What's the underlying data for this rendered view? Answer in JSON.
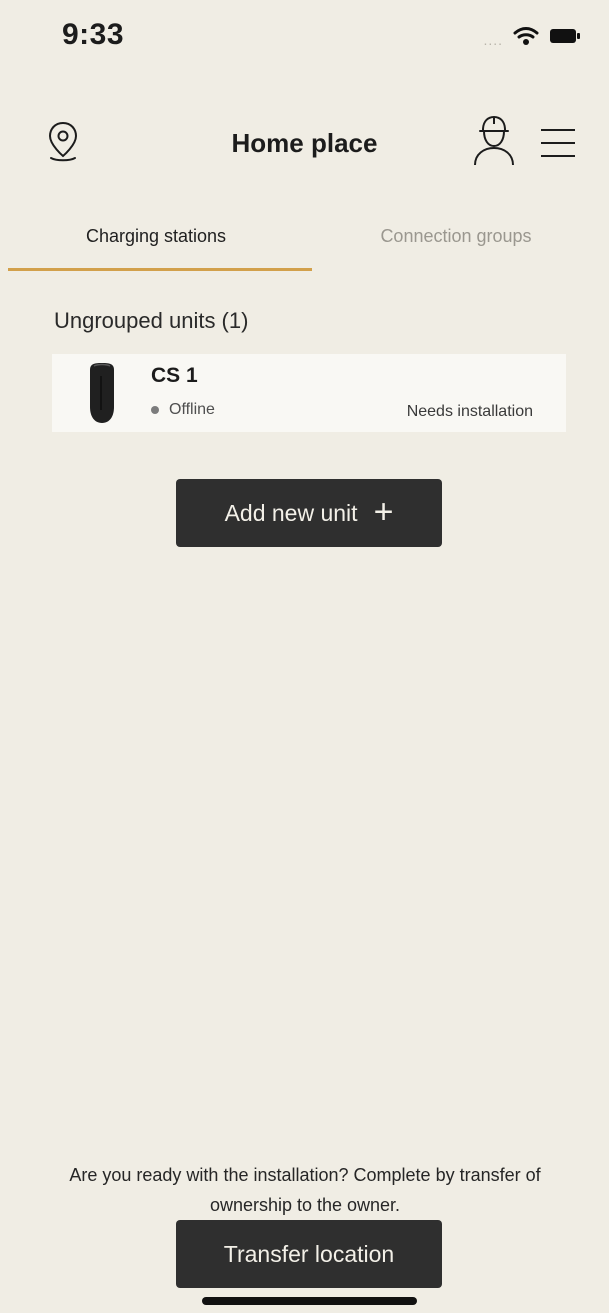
{
  "status_bar": {
    "time": "9:33",
    "signal_text": "....",
    "icons": [
      "wifi-icon",
      "battery-icon"
    ]
  },
  "header": {
    "title": "Home place",
    "icons": [
      "location-icon",
      "installer-icon",
      "menu-icon"
    ]
  },
  "tabs": [
    {
      "label": "Charging stations",
      "active": true
    },
    {
      "label": "Connection groups",
      "active": false
    }
  ],
  "section": {
    "title": "Ungrouped units (1)"
  },
  "unit": {
    "name": "CS 1",
    "status": "Offline",
    "note": "Needs installation"
  },
  "actions": {
    "add_label": "Add new unit",
    "add_icon": "+",
    "transfer_text": "Are you ready with the installation? Complete by transfer of ownership to the owner.",
    "transfer_label": "Transfer location"
  },
  "colors": {
    "background": "#f0ede4",
    "accent": "#d2a04b",
    "button": "#2f2f2f"
  }
}
